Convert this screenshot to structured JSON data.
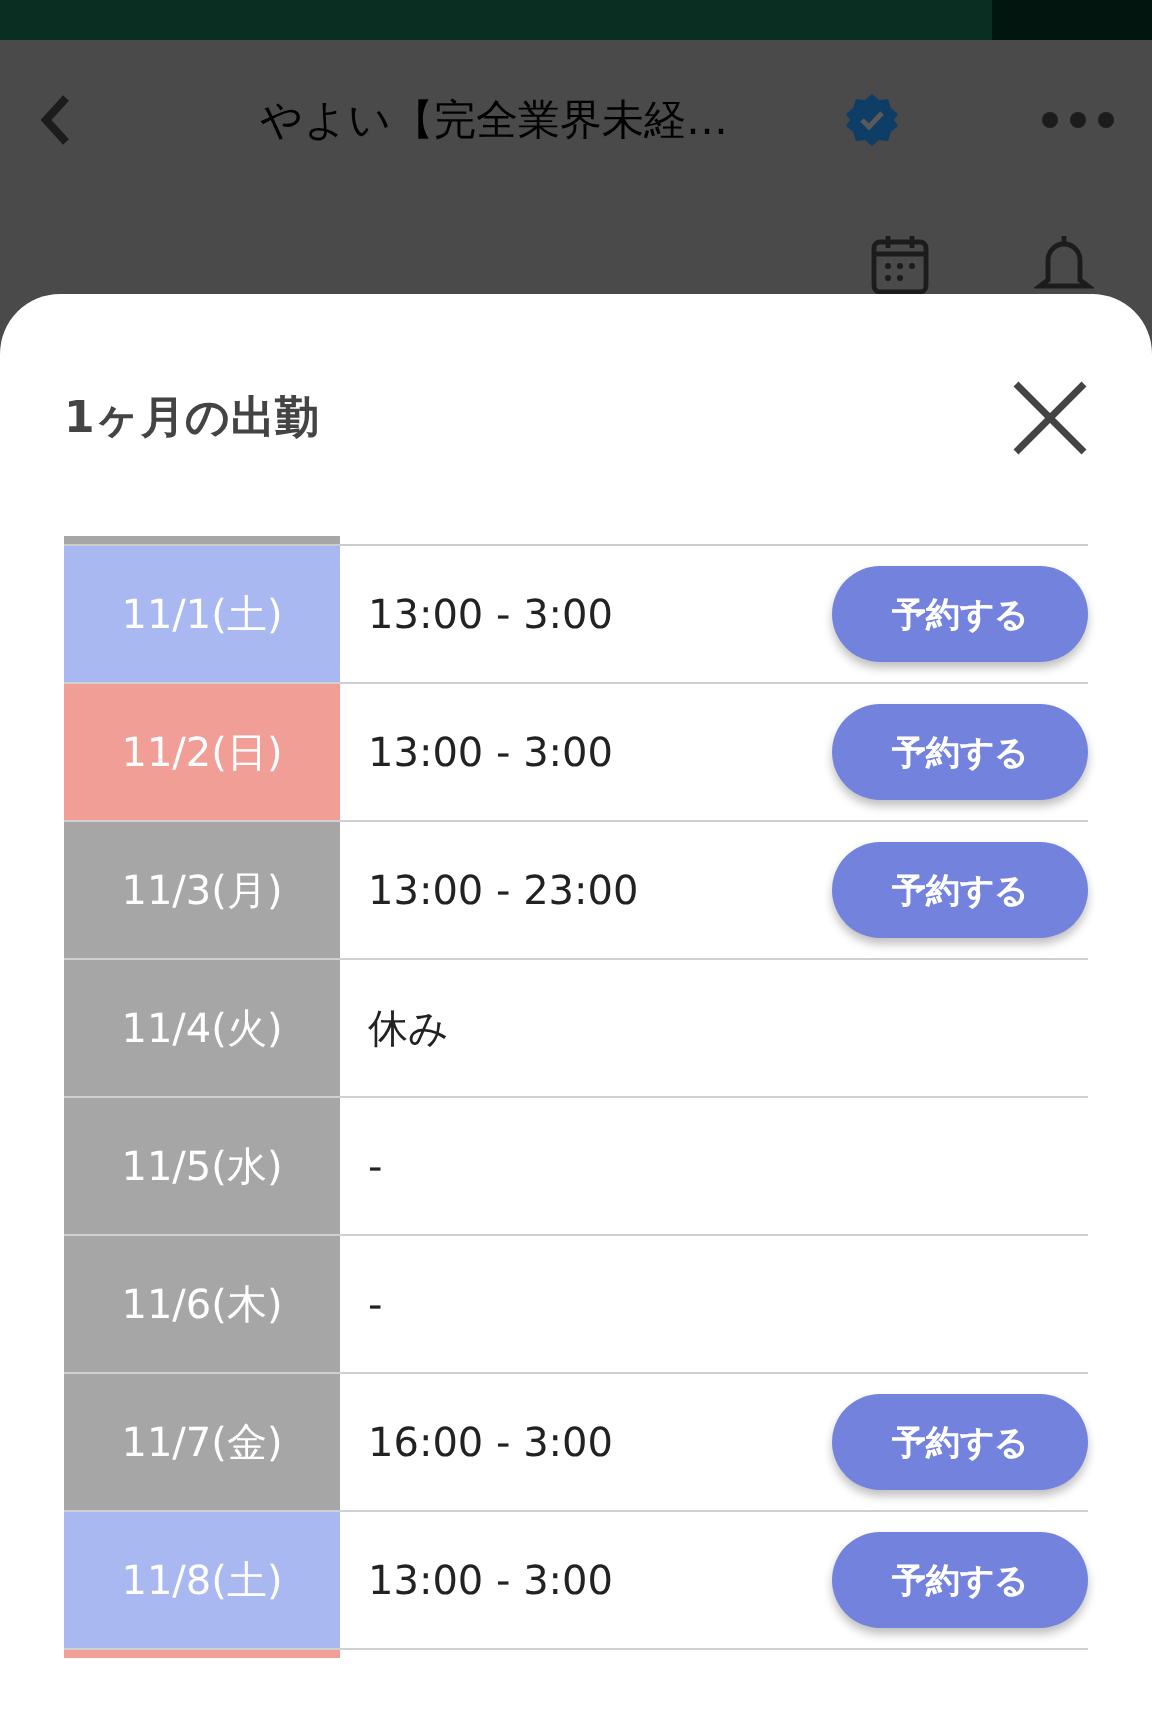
{
  "header": {
    "title": "やよい【完全業界未経…",
    "verified": true
  },
  "sheet": {
    "title": "1ヶ月の出勤"
  },
  "partial_above": {
    "color": "#a6a6a6"
  },
  "rows": [
    {
      "date": "11/1(土)",
      "color": "#a9b8f0",
      "hours": "13:00 - 3:00",
      "button": "予約する"
    },
    {
      "date": "11/2(日)",
      "color": "#f19f96",
      "hours": "13:00 - 3:00",
      "button": "予約する"
    },
    {
      "date": "11/3(月)",
      "color": "#a6a6a6",
      "hours": "13:00 - 23:00",
      "button": "予約する"
    },
    {
      "date": "11/4(火)",
      "color": "#a6a6a6",
      "hours": "休み"
    },
    {
      "date": "11/5(水)",
      "color": "#a6a6a6",
      "hours": "-"
    },
    {
      "date": "11/6(木)",
      "color": "#a6a6a6",
      "hours": "-"
    },
    {
      "date": "11/7(金)",
      "color": "#a6a6a6",
      "hours": "16:00 - 3:00",
      "button": "予約する"
    },
    {
      "date": "11/8(土)",
      "color": "#a9b8f0",
      "hours": "13:00 - 3:00",
      "button": "予約する"
    }
  ],
  "partial_below": {
    "color": "#f19f96"
  }
}
